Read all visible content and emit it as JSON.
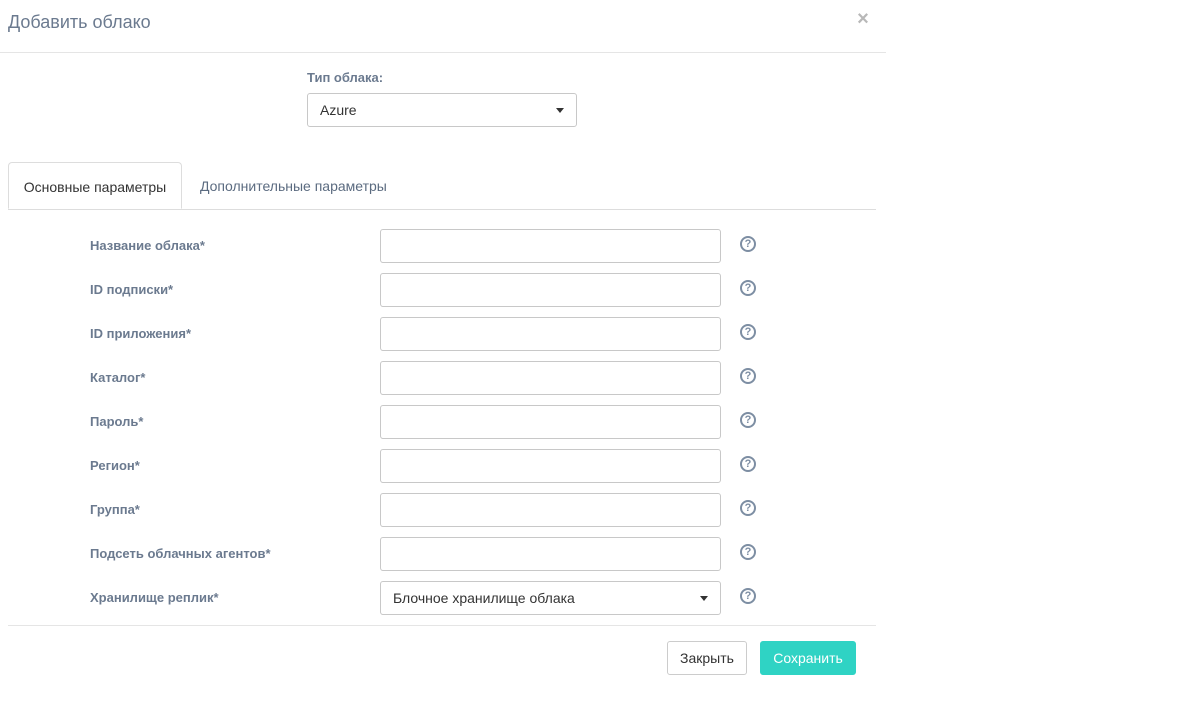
{
  "dialog": {
    "title": "Добавить облако",
    "close_icon": "×"
  },
  "cloud_type": {
    "label": "Тип облака:",
    "value": "Azure"
  },
  "tabs": [
    {
      "label": "Основные параметры",
      "active": true
    },
    {
      "label": "Дополнительные параметры",
      "active": false
    }
  ],
  "form": {
    "fields": [
      {
        "label": "Название облака*",
        "value": ""
      },
      {
        "label": "ID подписки*",
        "value": ""
      },
      {
        "label": "ID приложения*",
        "value": ""
      },
      {
        "label": "Каталог*",
        "value": ""
      },
      {
        "label": "Пароль*",
        "value": ""
      },
      {
        "label": "Регион*",
        "value": ""
      },
      {
        "label": "Группа*",
        "value": ""
      },
      {
        "label": "Подсеть облачных агентов*",
        "value": ""
      }
    ],
    "replica_storage": {
      "label": "Хранилище реплик*",
      "value": "Блочное хранилище облака"
    },
    "help_icon": "?"
  },
  "footer": {
    "close_label": "Закрыть",
    "save_label": "Сохранить"
  },
  "colors": {
    "accent": "#2fd3c4",
    "label": "#6b7a8f"
  }
}
